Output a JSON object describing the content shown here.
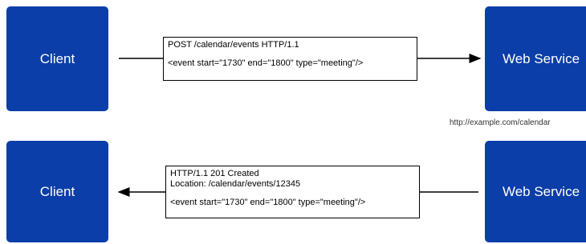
{
  "top_row": {
    "client_label": "Client",
    "service_label": "Web Service",
    "request": {
      "line1": "POST /calendar/events HTTP/1.1",
      "body": "<event start=\"1730\" end=\"1800\" type=\"meeting\"/>"
    },
    "service_url": "http://example.com/calendar"
  },
  "bottom_row": {
    "client_label": "Client",
    "service_label": "Web Service",
    "response": {
      "line1": "HTTP/1.1 201 Created",
      "line2": "Location: /calendar/events/12345",
      "body": "<event start=\"1730\" end=\"1800\" type=\"meeting\"/>"
    }
  },
  "colors": {
    "node_fill": "#0b3ea8",
    "node_text": "#ffffff",
    "connector": "#000000"
  }
}
